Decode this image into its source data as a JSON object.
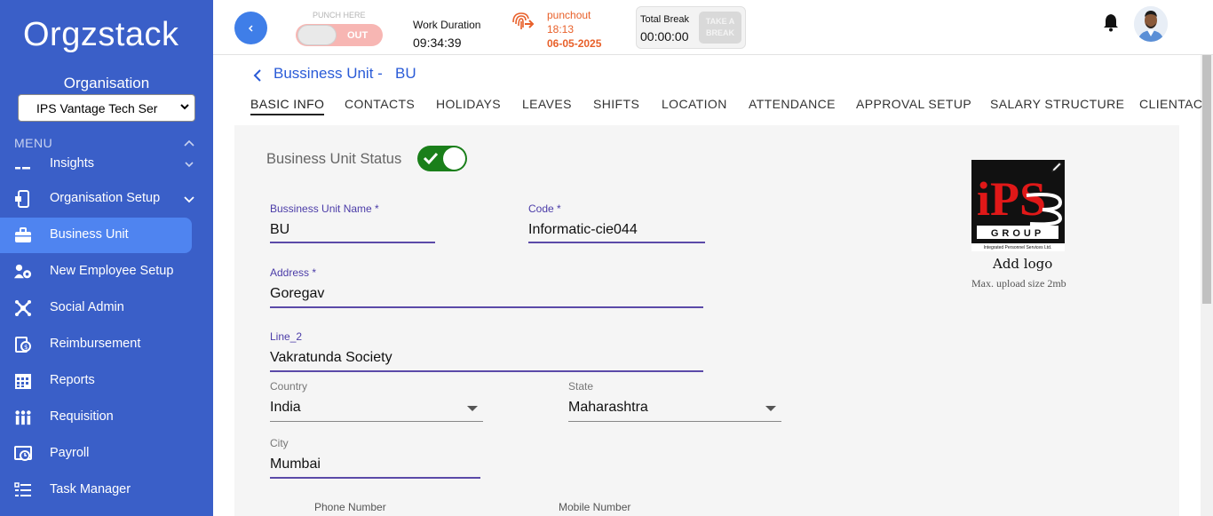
{
  "sidebar": {
    "logo": "Orgzstack",
    "org_label": "Organisation",
    "org_selected": "IPS Vantage Tech Ser",
    "menu_label": "MENU",
    "items": [
      {
        "label": "Insights",
        "icon": "insights-icon"
      },
      {
        "label": "Organisation Setup",
        "icon": "organisation-setup-icon"
      },
      {
        "label": "Business Unit",
        "icon": "briefcase-icon"
      },
      {
        "label": "New Employee Setup",
        "icon": "users-gear-icon"
      },
      {
        "label": "Social Admin",
        "icon": "social-icon"
      },
      {
        "label": "Reimbursement",
        "icon": "reimbursement-icon"
      },
      {
        "label": "Reports",
        "icon": "calendar-grid-icon"
      },
      {
        "label": "Requisition",
        "icon": "requisition-icon"
      },
      {
        "label": "Payroll",
        "icon": "payroll-icon"
      },
      {
        "label": "Task Manager",
        "icon": "task-list-icon"
      }
    ]
  },
  "topbar": {
    "punch_here": "PUNCH HERE",
    "punch_state": "OUT",
    "work_duration_label": "Work Duration",
    "work_duration_value": "09:34:39",
    "punchout_label": "punchout",
    "punchout_time": "18:13",
    "punchout_date": "06-05-2025",
    "total_break_label": "Total Break",
    "total_break_value": "00:00:00",
    "take_break_line1": "TAKE A",
    "take_break_line2": "BREAK",
    "accent_color": "#e8602a"
  },
  "breadcrumb": {
    "text": "Bussiness Unit -   BU"
  },
  "tabs": [
    "BASIC INFO",
    "CONTACTS",
    "HOLIDAYS",
    "LEAVES",
    "SHIFTS",
    "LOCATION",
    "ATTENDANCE",
    "APPROVAL SETUP",
    "SALARY STRUCTURE",
    "CLIENTAC"
  ],
  "form": {
    "status_label": "Business Unit Status",
    "status_on": true,
    "bu_name_label": "Bussiness Unit Name *",
    "bu_name_value": "BU",
    "code_label": "Code *",
    "code_value": "Informatic-cie044",
    "address_label": "Address *",
    "address_value": "Goregav",
    "line2_label": "Line_2",
    "line2_value": "Vakratunda Society",
    "country_label": "Country",
    "country_value": "India",
    "state_label": "State",
    "state_value": "Maharashtra",
    "city_label": "City",
    "city_value": "Mumbai",
    "phone_label": "Phone Number",
    "mobile_label": "Mobile Number"
  },
  "logo_panel": {
    "add_logo": "Add logo",
    "hint": "Max. upload size 2mb",
    "logo_letters": "iPS",
    "logo_group": "GROUP",
    "logo_caption": "Integrated Personnel Services Ltd."
  }
}
